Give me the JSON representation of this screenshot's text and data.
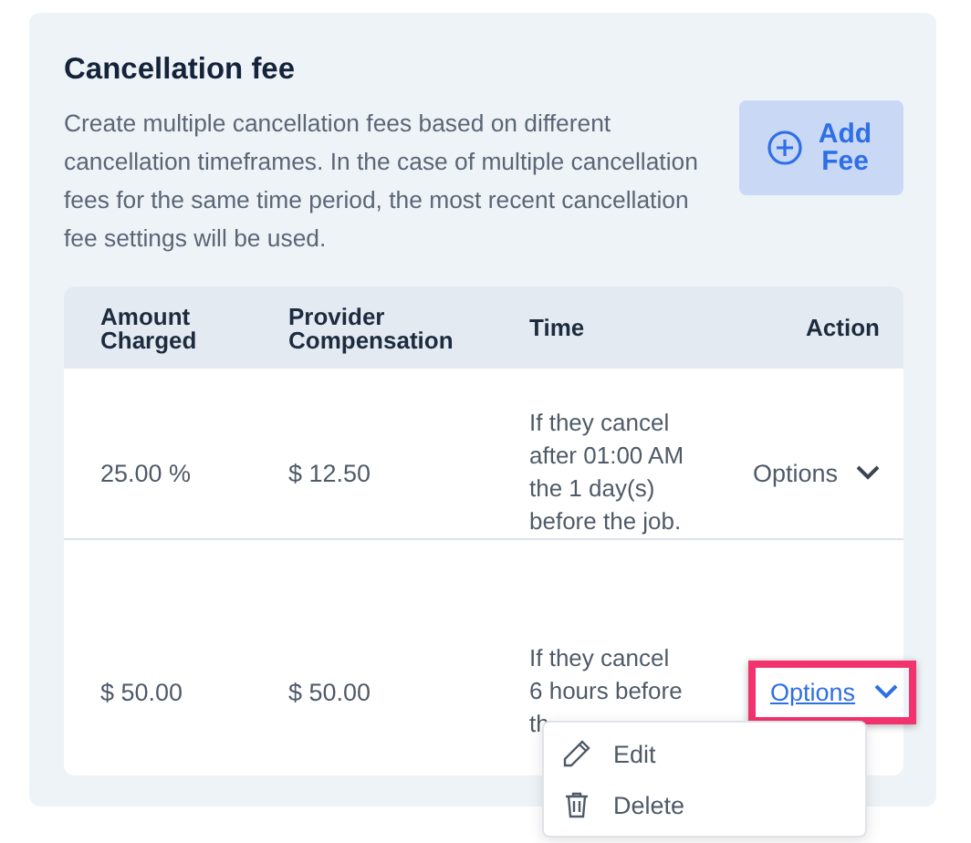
{
  "title": "Cancellation fee",
  "description": "Create multiple cancellation fees based on different cancellation timeframes. In the case of multiple cancellation fees for the same time period, the most recent cancellation fee settings will be used.",
  "add_button": {
    "label": "Add Fee"
  },
  "table": {
    "columns": [
      "Amount Charged",
      "Provider Compensation",
      "Time",
      "Action"
    ],
    "rows": [
      {
        "amount": "25.00 %",
        "compensation": "$ 12.50",
        "time": "If they cancel after 01:00 AM the 1 day(s) before the job.",
        "action": "Options",
        "expanded": false,
        "highlighted": false
      },
      {
        "amount": "$ 50.00",
        "compensation": "$ 50.00",
        "time": "If they cancel 6 hours before th",
        "action": "Options",
        "expanded": true,
        "highlighted": true
      }
    ]
  },
  "menu": {
    "items": [
      {
        "label": "Edit",
        "kind": "edit"
      },
      {
        "label": "Delete",
        "kind": "delete"
      }
    ]
  }
}
